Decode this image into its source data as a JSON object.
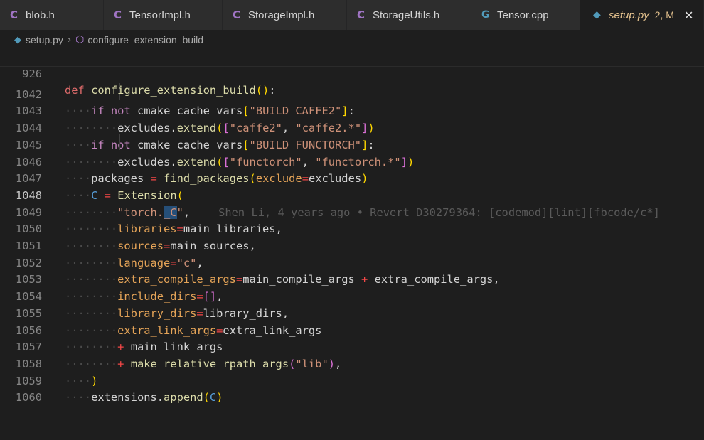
{
  "tabs": [
    {
      "label": "blob.h",
      "icon": "c-file-icon",
      "icon_glyph": "C"
    },
    {
      "label": "TensorImpl.h",
      "icon": "c-file-icon",
      "icon_glyph": "C"
    },
    {
      "label": "StorageImpl.h",
      "icon": "c-file-icon",
      "icon_glyph": "C"
    },
    {
      "label": "StorageUtils.h",
      "icon": "c-file-icon",
      "icon_glyph": "C"
    },
    {
      "label": "Tensor.cpp",
      "icon": "cpp-file-icon",
      "icon_glyph": "G"
    },
    {
      "label": "setup.py",
      "icon": "python-file-icon",
      "icon_glyph": "◆",
      "status": "2, M",
      "active": true
    }
  ],
  "breadcrumb": {
    "file": "setup.py",
    "symbol": "configure_extension_build"
  },
  "sticky_line": {
    "number": "926",
    "def_kw": "def",
    "name": "configure_extension_build",
    "rest": "():"
  },
  "lines": {
    "l1042": {
      "num": "1042"
    },
    "l1043": {
      "num": "1043"
    },
    "l1044": {
      "num": "1044"
    },
    "l1045": {
      "num": "1045"
    },
    "l1046": {
      "num": "1046"
    },
    "l1047": {
      "num": "1047"
    },
    "l1048": {
      "num": "1048"
    },
    "l1049": {
      "num": "1049"
    },
    "l1050": {
      "num": "1050"
    },
    "l1051": {
      "num": "1051"
    },
    "l1052": {
      "num": "1052"
    },
    "l1053": {
      "num": "1053"
    },
    "l1054": {
      "num": "1054"
    },
    "l1055": {
      "num": "1055"
    },
    "l1056": {
      "num": "1056"
    },
    "l1057": {
      "num": "1057"
    },
    "l1058": {
      "num": "1058"
    },
    "l1059": {
      "num": "1059"
    },
    "l1060": {
      "num": "1060"
    }
  },
  "code": {
    "if": "if",
    "not": "not",
    "cmake_cache_vars": "cmake_cache_vars",
    "build_caffe2": "\"BUILD_CAFFE2\"",
    "build_functorch": "\"BUILD_FUNCTORCH\"",
    "excludes": "excludes",
    "extend": "extend",
    "caffe2": "\"caffe2\"",
    "caffe2_star": "\"caffe2.*\"",
    "functorch": "\"functorch\"",
    "functorch_star": "\"functorch.*\"",
    "packages": "packages",
    "find_packages": "find_packages",
    "exclude": "exclude",
    "C": "C",
    "Extension": "Extension",
    "torch_C_a": "\"torch.",
    "torch_C_b": "_C",
    "torch_C_c": "\"",
    "blame": "Shen Li, 4 years ago • Revert D30279364: [codemod][lint][fbcode/c*]",
    "libraries": "libraries",
    "main_libraries": "main_libraries",
    "sources": "sources",
    "main_sources": "main_sources",
    "language": "language",
    "c_str": "\"c\"",
    "extra_compile_args": "extra_compile_args",
    "main_compile_args": "main_compile_args",
    "include_dirs": "include_dirs",
    "library_dirs": "library_dirs",
    "extra_link_args": "extra_link_args",
    "main_link_args": "main_link_args",
    "make_relative_rpath_args": "make_relative_rpath_args",
    "lib_str": "\"lib\"",
    "extensions": "extensions",
    "append": "append"
  },
  "colors": {
    "keyword": "#c586c0",
    "string": "#ce9178",
    "function": "#dcdcaa",
    "param": "#e5a458",
    "active_tab_text": "#e2c08d"
  }
}
